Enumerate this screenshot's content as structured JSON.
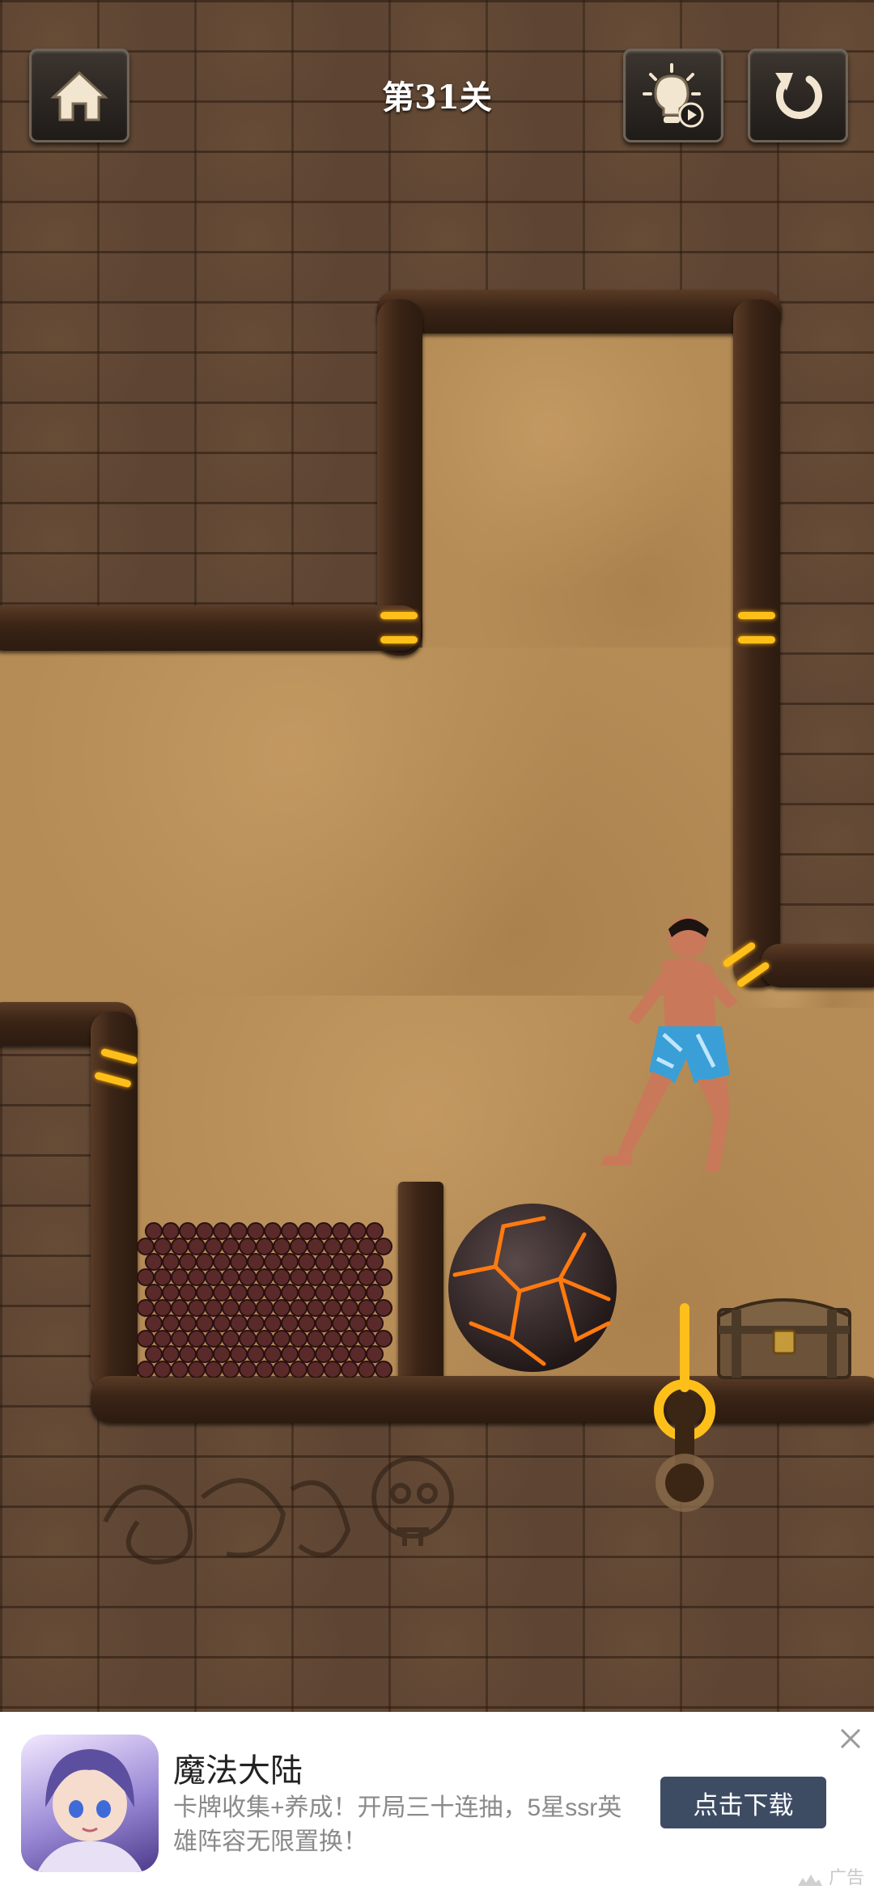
{
  "header": {
    "level_title": "第31关",
    "home_icon": "home-icon",
    "hint_icon": "lightbulb-video-icon",
    "restart_icon": "restart-icon"
  },
  "scene": {
    "hero": "muscular-man-blue-shorts",
    "boulder": "lava-boulder",
    "rocks": "dark-rock-pile",
    "chest": "treasure-chest",
    "pins": [
      "pin-top-left",
      "pin-top-right",
      "pin-mid-right",
      "pin-left",
      "pull-pin"
    ]
  },
  "ad": {
    "title": "魔法大陆",
    "description": "卡牌收集+养成！开局三十连抽，5星ssr英雄阵容无限置换！",
    "button_label": "点击下载",
    "tag_label": "广告",
    "close_icon": "close-icon"
  },
  "colors": {
    "pin": "#ffbf1a",
    "sand": "#b58b56",
    "button": "#3d4c63"
  }
}
